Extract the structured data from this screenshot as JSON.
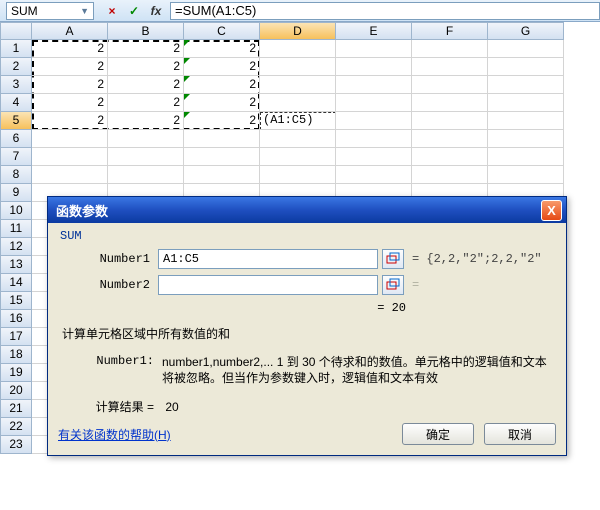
{
  "formula_bar": {
    "name_box": "SUM",
    "cancel_glyph": "×",
    "ok_glyph": "✓",
    "fx_glyph": "fx",
    "formula": "=SUM(A1:C5)"
  },
  "columns": [
    "A",
    "B",
    "C",
    "D",
    "E",
    "F",
    "G"
  ],
  "active_col": "D",
  "active_row": 5,
  "rows": [
    1,
    2,
    3,
    4,
    5,
    6,
    7,
    8,
    9,
    10,
    11,
    12,
    13,
    14,
    15,
    16,
    17,
    18,
    19,
    20,
    21,
    22,
    23
  ],
  "cells": {
    "A1": "2",
    "B1": "2",
    "C1": "2",
    "A2": "2",
    "B2": "2",
    "C2": "2",
    "A3": "2",
    "B3": "2",
    "C3": "2",
    "A4": "2",
    "B4": "2",
    "C4": "2",
    "A5": "2",
    "B5": "2",
    "C5": "2",
    "D5": "(A1:C5)"
  },
  "green_triangle_cells": [
    "C1",
    "C2",
    "C3",
    "C4",
    "C5"
  ],
  "dialog": {
    "title": "函数参数",
    "close_glyph": "X",
    "fn_name": "SUM",
    "fields": [
      {
        "label": "Number1",
        "value": "A1:C5",
        "preview": "= {2,2,\"2\";2,2,\"2\""
      },
      {
        "label": "Number2",
        "value": "",
        "preview": "="
      }
    ],
    "mid_result": "= 20",
    "description": "计算单元格区域中所有数值的和",
    "param_label": "Number1:",
    "param_text": "number1,number2,... 1 到 30 个待求和的数值。单元格中的逻辑值和文本将被忽略。但当作为参数键入时，逻辑值和文本有效",
    "result_label": "计算结果 =",
    "result_value": "20",
    "help_link": "有关该函数的帮助(H)",
    "ok": "确定",
    "cancel": "取消"
  }
}
